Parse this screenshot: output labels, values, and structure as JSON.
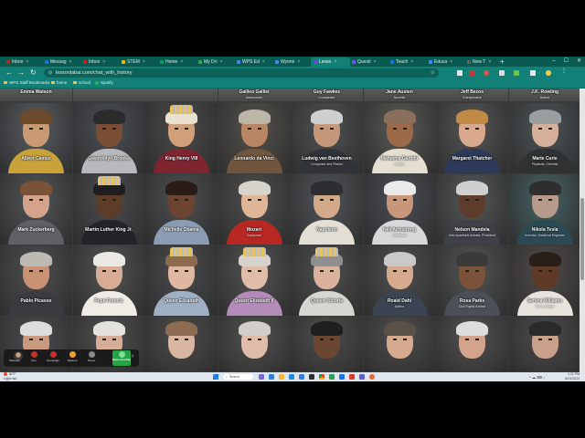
{
  "browser": {
    "tabs": [
      {
        "label": "Inbox",
        "color": "#c5221f"
      },
      {
        "label": "Messag",
        "color": "#1a73e8"
      },
      {
        "label": "Inbox",
        "color": "#c5221f"
      },
      {
        "label": "STEM",
        "color": "#f4b400"
      },
      {
        "label": "Home",
        "color": "#0f9d58"
      },
      {
        "label": "My Dri",
        "color": "#34a853"
      },
      {
        "label": "WPS Ed",
        "color": "#4285f4"
      },
      {
        "label": "Wyomi",
        "color": "#4285f4"
      },
      {
        "label": "Lesso",
        "color": "#6c4bd8"
      },
      {
        "label": "Questi",
        "color": "#7c4dff"
      },
      {
        "label": "Teach",
        "color": "#1a73e8"
      },
      {
        "label": "Educa",
        "color": "#4285f4"
      },
      {
        "label": "New T",
        "color": "#5f6368"
      }
    ],
    "active_tab_index": 8,
    "new_tab_glyph": "+",
    "window_controls": {
      "minimize": "–",
      "maximize": "☐",
      "close": "✕"
    },
    "nav": {
      "back": "←",
      "forward": "→",
      "reload": "↻",
      "home": "⌂"
    },
    "url": "lessonlabai.com/chat_with_history",
    "lock_icon": "⊙",
    "star_icon": "☆",
    "bookmarks": [
      {
        "label": "WPS Staff Bookmarks",
        "icon": "folder-icon"
      },
      {
        "label": "home",
        "icon": "folder-icon"
      },
      {
        "label": "school",
        "icon": "folder-icon"
      },
      {
        "label": "Spotify",
        "icon": "spotify-icon"
      }
    ]
  },
  "portraits_top": [
    {
      "name": "Emma Watson",
      "desc": ""
    },
    {
      "name": "",
      "desc": ""
    },
    {
      "name": "",
      "desc": ""
    },
    {
      "name": "Galileo Galilei",
      "desc": "Astronomer"
    },
    {
      "name": "Guy Fawkes",
      "desc": "Conspirator"
    },
    {
      "name": "Jane Austen",
      "desc": "Novelist"
    },
    {
      "name": "Jeff Bezos",
      "desc": "Entrepreneur"
    },
    {
      "name": "J.K. Rowling",
      "desc": "Author"
    }
  ],
  "portraits": [
    {
      "name": "Albert Camus",
      "desc": "",
      "bg": "#5a5e63",
      "skin": "#c99a74",
      "hair": "#6e4a2c",
      "body": "#c9a23a"
    },
    {
      "name": "Gwendolyn Brooks",
      "desc": "",
      "bg": "#4b5056",
      "skin": "#7a4e35",
      "hair": "#2b2b2b",
      "body": "#b7b9bd"
    },
    {
      "name": "King Henry VIII",
      "desc": "",
      "bg": "#4a4a4a",
      "skin": "#d0a07a",
      "hair": "#e9e2d0",
      "body": "#7e2530"
    },
    {
      "name": "Leonardo da Vinci",
      "desc": "",
      "bg": "#55524c",
      "skin": "#b88664",
      "hair": "#bcb6a6",
      "body": "#70563c"
    },
    {
      "name": "Ludwig van Beethoven",
      "desc": "Composer and Pianist",
      "bg": "#505354",
      "skin": "#c5987a",
      "hair": "#cfcfcf",
      "body": "#30343a"
    },
    {
      "name": "Mahatma Gandhi",
      "desc": "Leader",
      "bg": "#5a5a55",
      "skin": "#9c6a49",
      "hair": "#8a6f5a",
      "body": "#e5dfd1"
    },
    {
      "name": "Margaret Thatcher",
      "desc": "",
      "bg": "#565656",
      "skin": "#d9a98d",
      "hair": "#c08a45",
      "body": "#2d3a5a"
    },
    {
      "name": "Marie Curie",
      "desc": "Physicist, Chemist",
      "bg": "#4c5558",
      "skin": "#d6b09b",
      "hair": "#9b9ea1",
      "body": "#2f3233"
    },
    {
      "name": "Mark Zuckerberg",
      "desc": "",
      "bg": "#525659",
      "skin": "#d3a38b",
      "hair": "#7a5235",
      "body": "#5f6166"
    },
    {
      "name": "Martin Luther King Jr.",
      "desc": "",
      "bg": "#4a4c4e",
      "skin": "#5d3c2a",
      "hair": "#1e1e1e",
      "body": "#22242a"
    },
    {
      "name": "Michelle Obama",
      "desc": "",
      "bg": "#4e4f53",
      "skin": "#6c4532",
      "hair": "#2a1d17",
      "body": "#8b9db5"
    },
    {
      "name": "Mozart",
      "desc": "Composer",
      "bg": "#4f4f4f",
      "skin": "#dfb598",
      "hair": "#d7d4cc",
      "body": "#b82722"
    },
    {
      "name": "Napoleon",
      "desc": "",
      "bg": "#52565a",
      "skin": "#d2a989",
      "hair": "#2e2d32",
      "body": "#e3dfd5"
    },
    {
      "name": "Neil Armstrong",
      "desc": "Astronaut",
      "bg": "#4a4e55",
      "skin": "#c89679",
      "hair": "#eaeaea",
      "body": "#d8d8d8"
    },
    {
      "name": "Nelson Mandela",
      "desc": "Anti-Apartheid Activist, President",
      "bg": "#55585a",
      "skin": "#5e3c2b",
      "hair": "#cfcfcf",
      "body": "#3e4148"
    },
    {
      "name": "Nikola Tesla",
      "desc": "Inventor, Electrical Engineer",
      "bg": "#476466",
      "skin": "#b69b8c",
      "hair": "#2e2e2e",
      "body": "#2b4a54"
    },
    {
      "name": "Pablo Picasso",
      "desc": "",
      "bg": "#4e4f50",
      "skin": "#c99275",
      "hair": "#bdbab4",
      "body": "#3a3b3e"
    },
    {
      "name": "Pope Francis",
      "desc": "",
      "bg": "#525354",
      "skin": "#d6ad94",
      "hair": "#ebe9e4",
      "body": "#efece6"
    },
    {
      "name": "Queen Elizabeth",
      "desc": "",
      "bg": "#4b4c4f",
      "skin": "#dfb8a2",
      "hair": "#8e6a4e",
      "body": "#9fb0c5"
    },
    {
      "name": "Queen Elizabeth II",
      "desc": "",
      "bg": "#545454",
      "skin": "#e0bcaa",
      "hair": "#d6d3cf",
      "body": "#b48cb9"
    },
    {
      "name": "Queen Victoria",
      "desc": "",
      "bg": "#4f4f4f",
      "skin": "#d8b29d",
      "hair": "#8f8f8f",
      "body": "#d8d6d0"
    },
    {
      "name": "Roald Dahl",
      "desc": "Author",
      "bg": "#505050",
      "skin": "#d6aa8f",
      "hair": "#c9c9c9",
      "body": "#3b4452"
    },
    {
      "name": "Rosa Parks",
      "desc": "Civil Rights Activist",
      "bg": "#545555",
      "skin": "#7b523a",
      "hair": "#3a3a3a",
      "body": "#4b4f57"
    },
    {
      "name": "Serena Williams",
      "desc": "Tennis Player",
      "bg": "#4f4b49",
      "skin": "#5e3a27",
      "hair": "#2a1e18",
      "body": "#e8e3dc"
    }
  ],
  "portraits_bottom": [
    {
      "name": "",
      "bg": "#4c4d50",
      "skin": "#c99a7d",
      "hair": "#ddd"
    },
    {
      "name": "",
      "bg": "#505052",
      "skin": "#d6ad96",
      "hair": "#e4e2dc"
    },
    {
      "name": "",
      "bg": "#4d4d4d",
      "skin": "#d9b6a1",
      "hair": "#8d6b50"
    },
    {
      "name": "",
      "bg": "#535353",
      "skin": "#e0bdaa",
      "hair": "#d2cfcb"
    },
    {
      "name": "",
      "bg": "#4e4e4e",
      "skin": "#6b4631",
      "hair": "#1f1f1f"
    },
    {
      "name": "",
      "bg": "#4f4f4f",
      "skin": "#d6aa8f",
      "hair": "#5a5147"
    },
    {
      "name": "",
      "bg": "#535353",
      "skin": "#d3a38b",
      "hair": "#ddd"
    },
    {
      "name": "",
      "bg": "#4c4c4c",
      "skin": "#c9a08a",
      "hair": "#2a2a2a"
    }
  ],
  "recorder": {
    "buttons": [
      {
        "label": "Webcam",
        "color": "#7a7a7a"
      },
      {
        "label": "Pen",
        "color": "#c9302c"
      },
      {
        "label": "Rectangle",
        "color": "#c9302c"
      },
      {
        "label": "Stickers",
        "color": "#f0a12b"
      },
      {
        "label": "Pause",
        "color": "#888888"
      }
    ],
    "share_label": "Share recording",
    "chevron": "‹"
  },
  "taskbar": {
    "weather_temp": "82°F",
    "weather_desc": "Light rain",
    "search_label": "Search",
    "time": "1:21 PM",
    "date": "8/21/2023",
    "tray_icons": "^ ☁ ⌨ ♪"
  }
}
